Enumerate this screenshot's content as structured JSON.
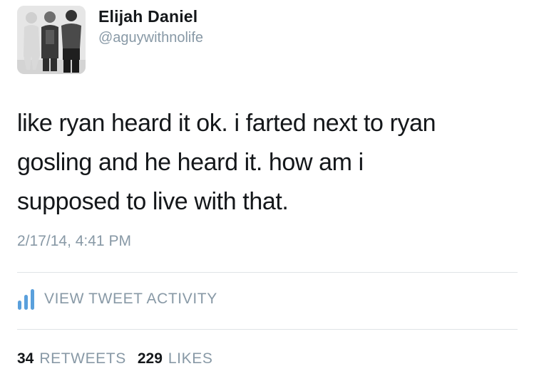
{
  "user": {
    "display_name": "Elijah Daniel",
    "handle": "@aguywithnolife",
    "avatar_icon": "profile-photo"
  },
  "tweet": {
    "lines": [
      "like ryan heard it ok. i farted next to ryan",
      "gosling and he heard it. how am i",
      "supposed to live with that."
    ],
    "timestamp": "2/17/14, 4:41 PM"
  },
  "activity": {
    "icon": "bar-chart-icon",
    "label": "VIEW TWEET ACTIVITY"
  },
  "stats": {
    "retweets_count": "34",
    "retweets_label": "RETWEETS",
    "likes_count": "229",
    "likes_label": "LIKES"
  },
  "colors": {
    "text": "#14171a",
    "secondary": "#8899a6",
    "divider": "#dfe3e6"
  }
}
